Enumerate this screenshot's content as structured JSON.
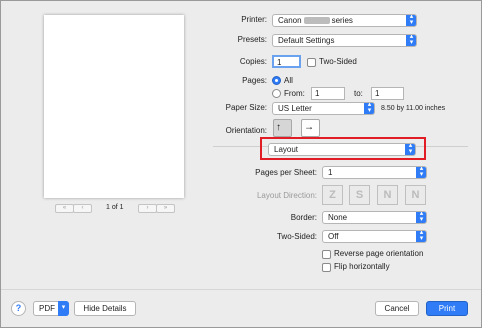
{
  "preview": {
    "page_indicator": "1 of 1",
    "first_label": "«",
    "prev_label": "‹",
    "next_label": "›",
    "last_label": "»"
  },
  "printer": {
    "label": "Printer:",
    "value_prefix": "Canon",
    "value_suffix": "series"
  },
  "presets": {
    "label": "Presets:",
    "value": "Default Settings"
  },
  "copies": {
    "label": "Copies:",
    "value": "1",
    "two_sided_label": "Two-Sided"
  },
  "pages": {
    "label": "Pages:",
    "all_label": "All",
    "from_label": "From:",
    "from_value": "1",
    "to_label": "to:",
    "to_value": "1"
  },
  "paper_size": {
    "label": "Paper Size:",
    "value": "US Letter",
    "dimensions": "8.50 by 11.00 inches"
  },
  "orientation": {
    "label": "Orientation:",
    "portrait_glyph": "↑",
    "landscape_glyph": "↑"
  },
  "section": {
    "value": "Layout"
  },
  "layout": {
    "pages_per_sheet_label": "Pages per Sheet:",
    "pages_per_sheet_value": "1",
    "layout_direction_label": "Layout Direction:",
    "directions": [
      "Z",
      "S",
      "N",
      "N"
    ],
    "border_label": "Border:",
    "border_value": "None",
    "two_sided_label": "Two-Sided:",
    "two_sided_value": "Off",
    "reverse_label": "Reverse page orientation",
    "flip_label": "Flip horizontally"
  },
  "footer": {
    "help_label": "?",
    "pdf_label": "PDF",
    "hide_details_label": "Hide Details",
    "cancel_label": "Cancel",
    "print_label": "Print"
  },
  "colors": {
    "accent": "#2f7cf6",
    "highlight_border": "#e11c24"
  }
}
